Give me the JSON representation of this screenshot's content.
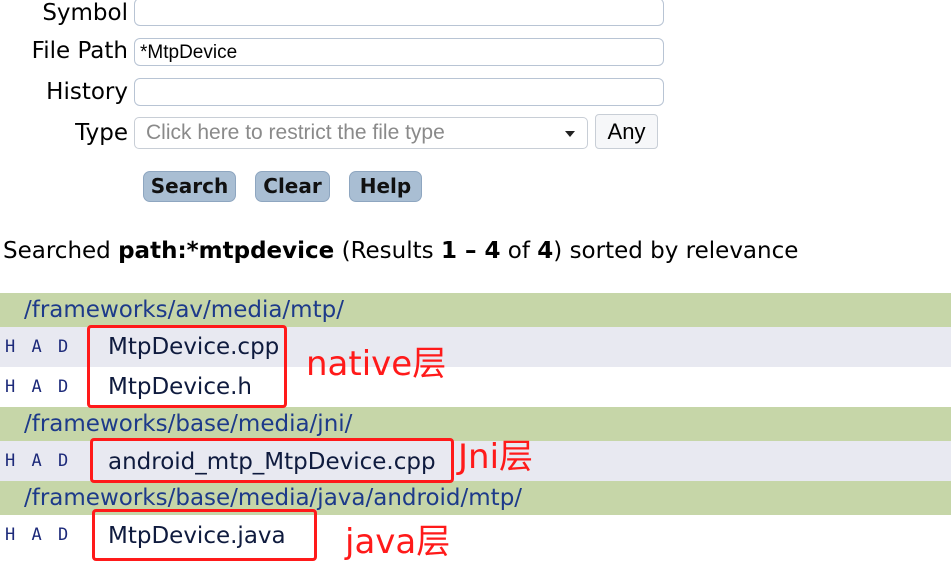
{
  "form": {
    "symbol_label": "Symbol",
    "symbol_value": "",
    "filepath_label": "File Path",
    "filepath_value": "*MtpDevice",
    "history_label": "History",
    "history_value": "",
    "type_label": "Type",
    "type_placeholder": "Click here to restrict the file type",
    "any_label": "Any"
  },
  "buttons": {
    "search": "Search",
    "clear": "Clear",
    "help": "Help"
  },
  "summary": {
    "prefix": "Searched ",
    "query": "path:*mtpdevice",
    "mid1": " (Results ",
    "range": "1 – 4",
    "mid2": " of ",
    "total": "4",
    "suffix": ") sorted by relevance"
  },
  "results": {
    "had_label": "H A D",
    "dirs": [
      {
        "path": "/frameworks/av/media/mtp/",
        "files": [
          "MtpDevice.cpp",
          "MtpDevice.h"
        ]
      },
      {
        "path": "/frameworks/base/media/jni/",
        "files": [
          "android_mtp_MtpDevice.cpp"
        ]
      },
      {
        "path": "/frameworks/base/media/java/android/mtp/",
        "files": [
          "MtpDevice.java"
        ]
      }
    ]
  },
  "annotations": {
    "native": "native层",
    "jni": "Jni层",
    "java": "java层",
    "color": "#ff1a1a"
  }
}
